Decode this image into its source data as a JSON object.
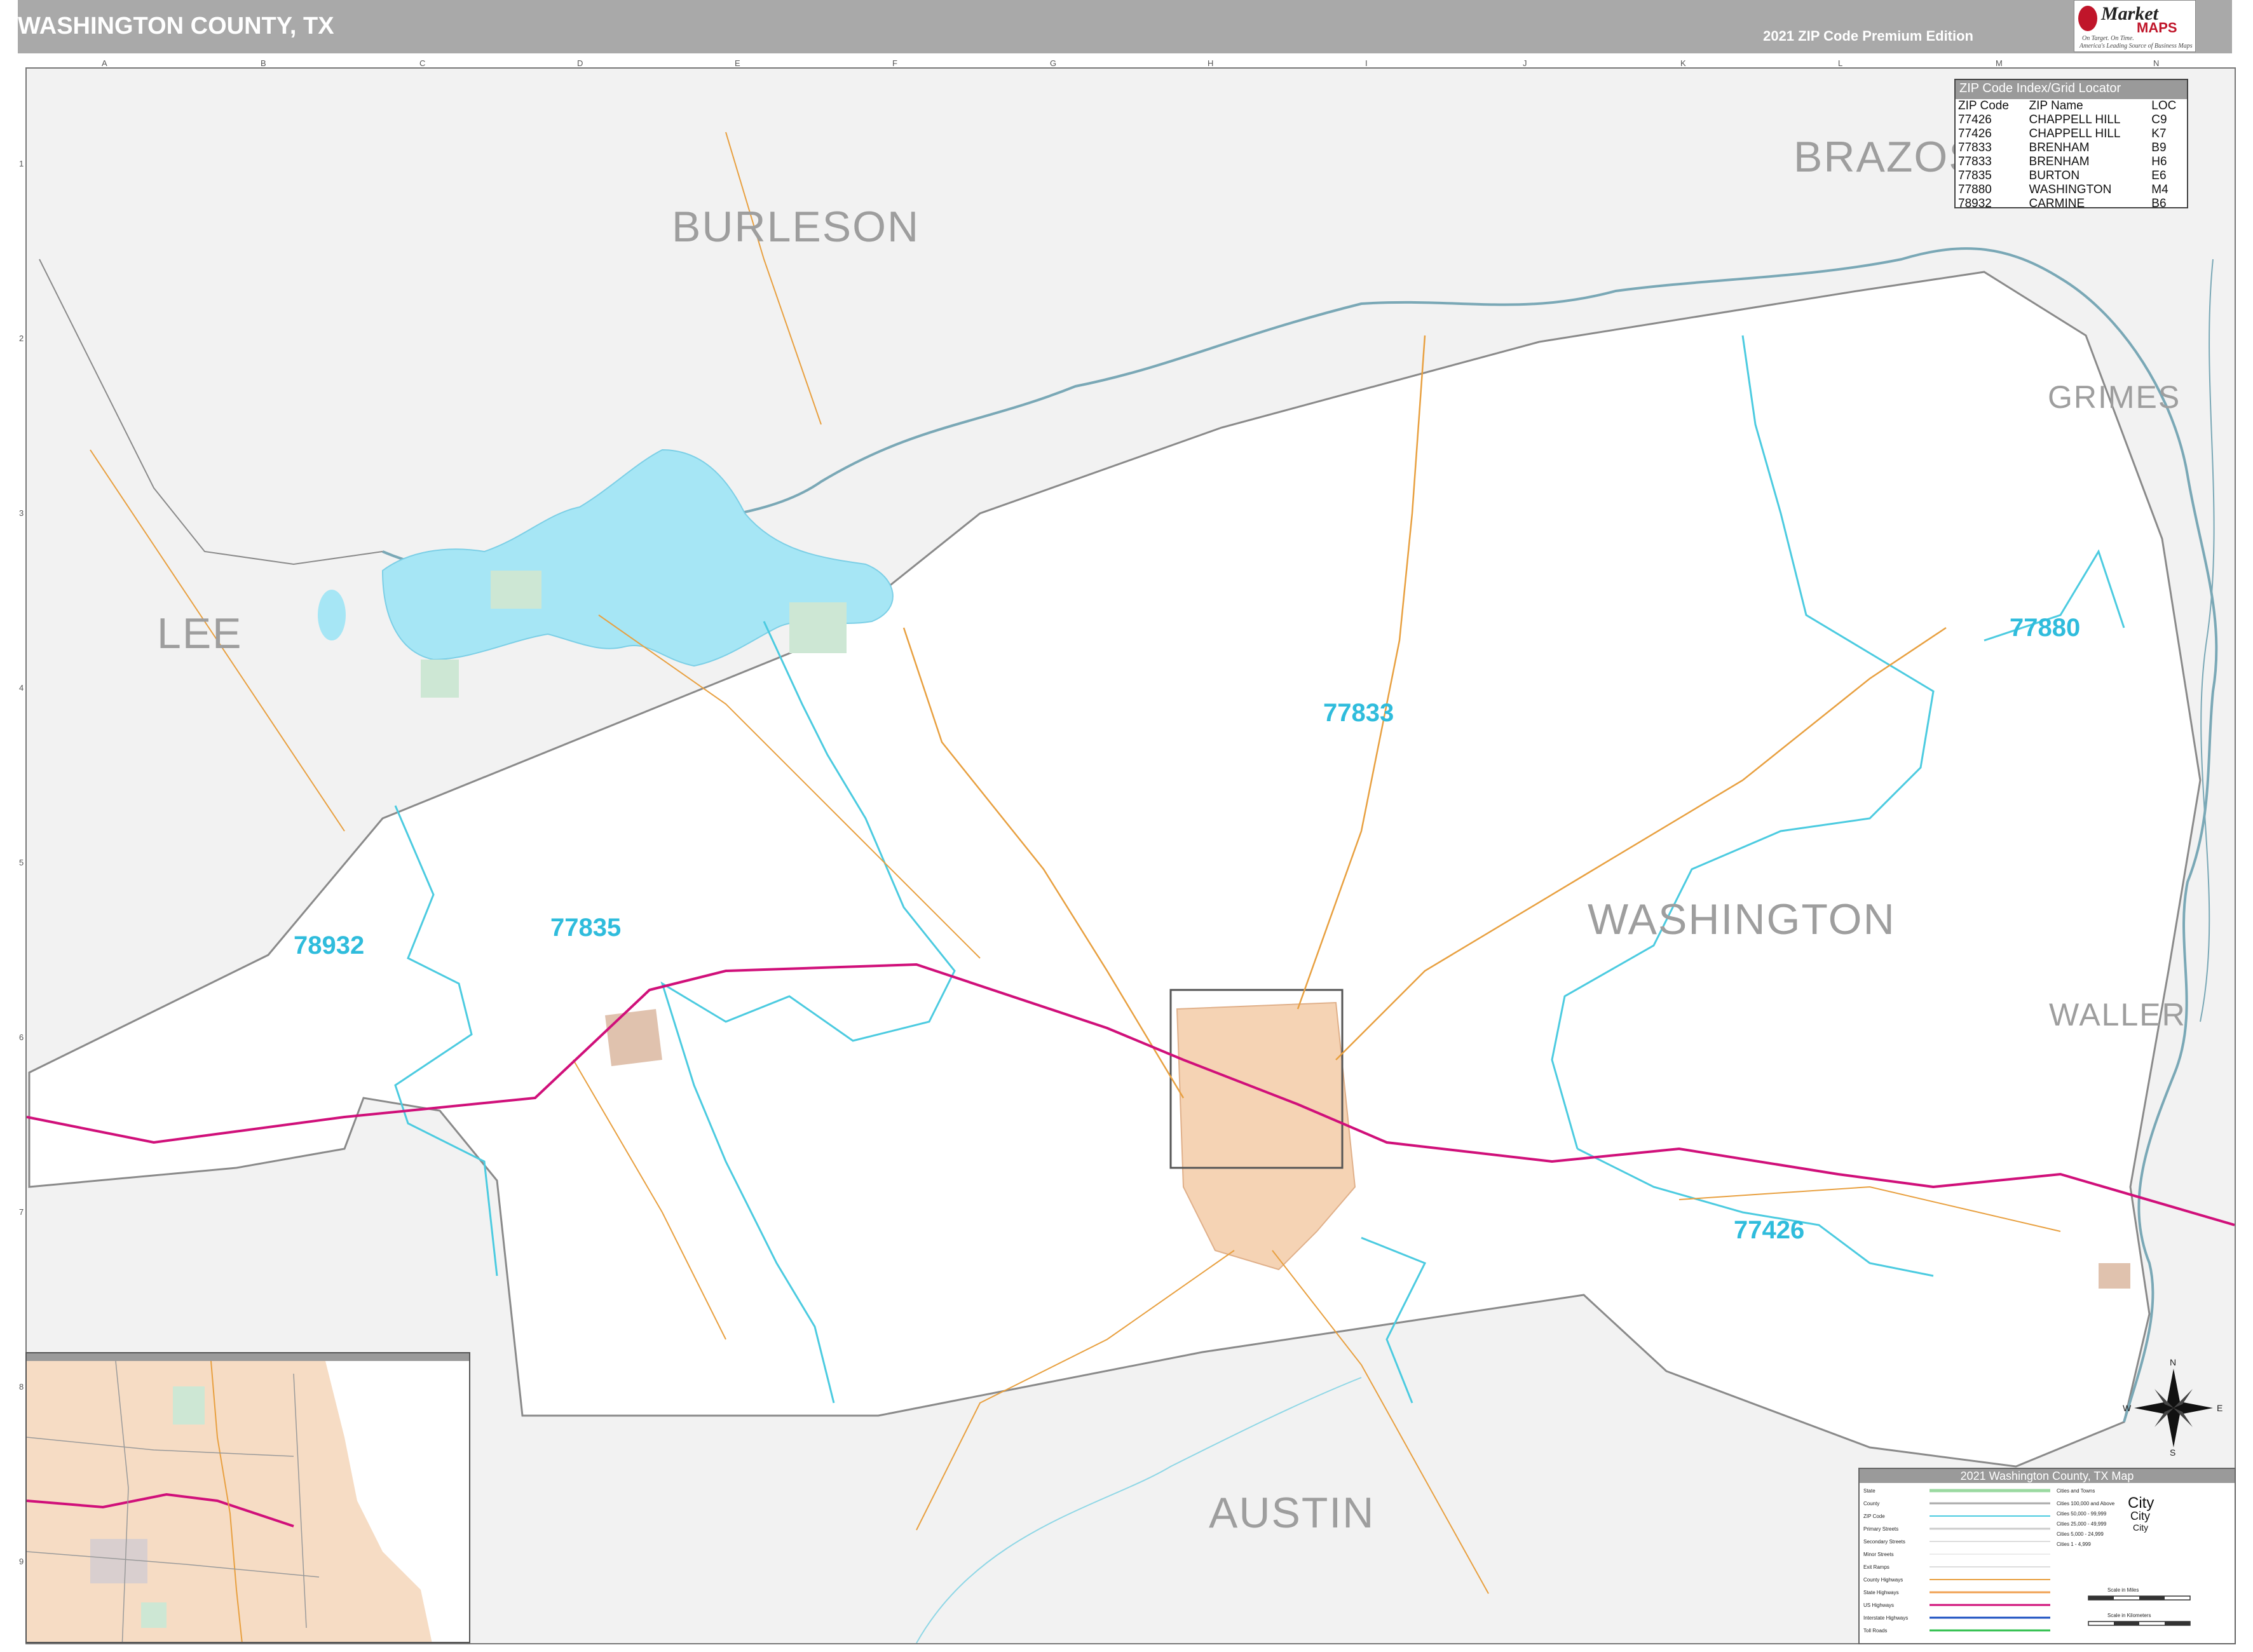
{
  "header": {
    "title": "WASHINGTON COUNTY, TX",
    "edition": "2021 ZIP Code Premium Edition",
    "logo_brand": "Market",
    "logo_maps": "MAPS",
    "logo_tagline1": "On Target. On Time.",
    "logo_tagline2": "America's Leading Source of Business Maps"
  },
  "grid": {
    "columns": [
      "A",
      "B",
      "C",
      "D",
      "E",
      "F",
      "G",
      "H",
      "I",
      "J",
      "K",
      "L",
      "M",
      "N"
    ],
    "rows": [
      "1",
      "2",
      "3",
      "4",
      "5",
      "6",
      "7",
      "8",
      "9"
    ]
  },
  "counties": {
    "burleson": "BURLESON",
    "brazos": "BRAZOS",
    "grimes": "GRIMES",
    "lee": "LEE",
    "washington": "WASHINGTON",
    "waller": "WALLER",
    "austin": "AUSTIN"
  },
  "zip_labels": {
    "z77880": "77880",
    "z77833": "77833",
    "z78932": "78932",
    "z77835": "77835",
    "z77426": "77426"
  },
  "zip_index": {
    "title": "ZIP Code Index/Grid Locator",
    "columns": [
      "ZIP Code",
      "ZIP Name",
      "LOC"
    ],
    "rows": [
      [
        "77426",
        "CHAPPELL HILL",
        "C9"
      ],
      [
        "77426",
        "CHAPPELL HILL",
        "K7"
      ],
      [
        "77833",
        "BRENHAM",
        "B9"
      ],
      [
        "77833",
        "BRENHAM",
        "H6"
      ],
      [
        "77835",
        "BURTON",
        "E6"
      ],
      [
        "77880",
        "WASHINGTON",
        "M4"
      ],
      [
        "78932",
        "CARMINE",
        "B6"
      ]
    ]
  },
  "legend": {
    "title": "2021 Washington County, TX Map",
    "items": [
      "State",
      "County",
      "ZIP Code",
      "Primary Streets",
      "Secondary Streets",
      "Minor Streets",
      "Exit Ramps",
      "County Highways",
      "State Highways",
      "US Highways",
      "Interstate Highways",
      "Toll Roads"
    ],
    "cities_title": "Cities and Towns",
    "city_sizes": [
      "Cities 100,000 and Above",
      "Cities 50,000 - 99,999",
      "Cities 25,000 - 49,999",
      "Cities 5,000 - 24,999",
      "Cities 1 - 4,999"
    ],
    "big_city": "City",
    "mid_city": "City",
    "small_city": "City",
    "scale_miles": "Scale in Miles",
    "scale_km": "Scale in Kilometers"
  },
  "compass": {
    "n": "N",
    "s": "S",
    "e": "E",
    "w": "W"
  },
  "colors": {
    "water": "#a6e6f5",
    "zip_boundary": "#4ccbe0",
    "us_highway": "#d0107a",
    "county_boundary": "#8a8a8a",
    "city_fill": "#f5d3b4",
    "park": "#cde7d4",
    "roads": "#e8a040"
  }
}
